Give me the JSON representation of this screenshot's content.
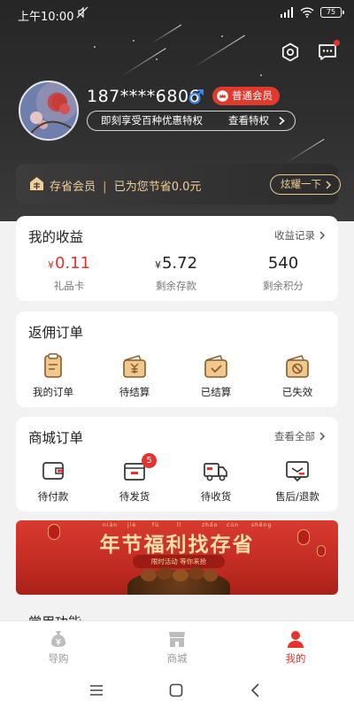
{
  "status_bar": {
    "time": "上午10:00",
    "battery": "75"
  },
  "header": {
    "phone": "187****6806",
    "member_badge": "普通会员",
    "privilege_text": "即刻享受百种优惠特权",
    "privilege_link": "查看特权"
  },
  "savings": {
    "label": "存省会员",
    "text": "已为您节省0.0元",
    "button": "炫耀一下"
  },
  "earnings": {
    "title": "我的收益",
    "link": "收益记录",
    "items": [
      {
        "currency": "¥",
        "value": "0.11",
        "label": "礼品卡",
        "color": "#e5322d"
      },
      {
        "currency": "¥",
        "value": "5.72",
        "label": "剩余存款",
        "color": "#222222"
      },
      {
        "currency": "",
        "value": "540",
        "label": "剩余积分",
        "color": "#222222"
      }
    ]
  },
  "rebate_orders": {
    "title": "返佣订单",
    "items": [
      {
        "label": "我的订单",
        "icon": "clipboard-icon"
      },
      {
        "label": "待结算",
        "icon": "wallet-yen-icon"
      },
      {
        "label": "已结算",
        "icon": "wallet-check-icon"
      },
      {
        "label": "已失效",
        "icon": "wallet-ban-icon"
      }
    ]
  },
  "mall_orders": {
    "title": "商城订单",
    "link": "查看全部",
    "items": [
      {
        "label": "待付款",
        "icon": "wallet-icon"
      },
      {
        "label": "待发货",
        "icon": "box-icon",
        "badge": "5"
      },
      {
        "label": "待收货",
        "icon": "truck-icon"
      },
      {
        "label": "售后/退款",
        "icon": "message-box-icon"
      }
    ]
  },
  "promo": {
    "title": "年节福利找存省",
    "subtitle": "限时活动 等你来抢",
    "pinyin": [
      "nián",
      "jié",
      "fú",
      "lì",
      "zhǎo",
      "cún",
      "shěng"
    ]
  },
  "section_peek": {
    "title": "常用功能"
  },
  "bottom_nav": {
    "items": [
      {
        "label": "导购",
        "icon": "moneybag-icon",
        "active": false
      },
      {
        "label": "商城",
        "icon": "store-icon",
        "active": false
      },
      {
        "label": "我的",
        "icon": "person-icon",
        "active": true
      }
    ]
  },
  "colors": {
    "accent": "#e5322d",
    "gold": "#f1cf9a",
    "dark": "#2c2c2c",
    "icon_brown": "#8a5a2b"
  }
}
